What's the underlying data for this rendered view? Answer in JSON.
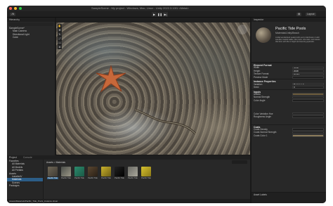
{
  "title": "SampleScene - My project - Windows, Mac, Linux - Unity 2022.3.10f1 <Metal>",
  "toolbar": {
    "account": "JN",
    "layout": "Layout"
  },
  "hierarchy": {
    "tab": "Hierarchy",
    "items": [
      "SampleScene*",
      "Main Camera",
      "Directional Light",
      "Cube"
    ]
  },
  "scene": {
    "tabs": [
      "Scene",
      "Game"
    ]
  },
  "inspector": {
    "tab": "Inspector",
    "material_title": "Pacific Tide Pools",
    "material_sub": "Materials/Unity/Beach",
    "description": "A tidal wonderland sealed with every tidal brawl. A wild sea-like coastal walks, tide pools, sea stars, and waves that brim with life in bright and teeming splendor.",
    "sections": {
      "element": "Element Format",
      "instance": "Instance Properties",
      "inputs": "Inputs",
      "coats": "Coats"
    },
    "fields": [
      {
        "label": "Width",
        "value": "2048"
      },
      {
        "label": "Height",
        "value": "2048"
      },
      {
        "label": "Texture Format",
        "value": "RGBA"
      },
      {
        "label": "Preview Mode",
        "value": ""
      },
      {
        "label": "Variation",
        "value": "Beginner II"
      },
      {
        "label": "Seed",
        "value": "0"
      },
      {
        "label": "Albedo",
        "value": ""
      },
      {
        "label": "Normal Strength",
        "value": ""
      },
      {
        "label": "Color Angle",
        "value": ""
      },
      {
        "label": "Color Variation Hue",
        "value": ""
      },
      {
        "label": "Roughness Angle",
        "value": ""
      },
      {
        "label": "Coats Density",
        "value": ""
      },
      {
        "label": "Coats Normal Strength",
        "value": ""
      },
      {
        "label": "Coats Color 1",
        "value": ""
      }
    ],
    "asset_labels": "Asset Labels"
  },
  "project": {
    "tabs": [
      "Project",
      "Console"
    ],
    "tree": [
      "Favorites",
      "All Materials",
      "All Models",
      "All Prefabs",
      "Assets",
      "InstalledV",
      "Materials",
      "Scenes",
      "Packages"
    ],
    "breadcrumb": [
      "Assets",
      "Materials"
    ],
    "thumbnails": [
      "Pacific Tide",
      "Pacific Tide",
      "Pacific Tide",
      "Pacific Tide",
      "Pacific Tide",
      "Pacific Tide",
      "Pacific Tide",
      "Pacific Tide"
    ],
    "path": "Assets/Materials/Pacific_Tide_Pools_instance.sbsar"
  },
  "colors": {
    "accent": "#2c5d87",
    "bg": "#191919",
    "panel": "#282828"
  }
}
